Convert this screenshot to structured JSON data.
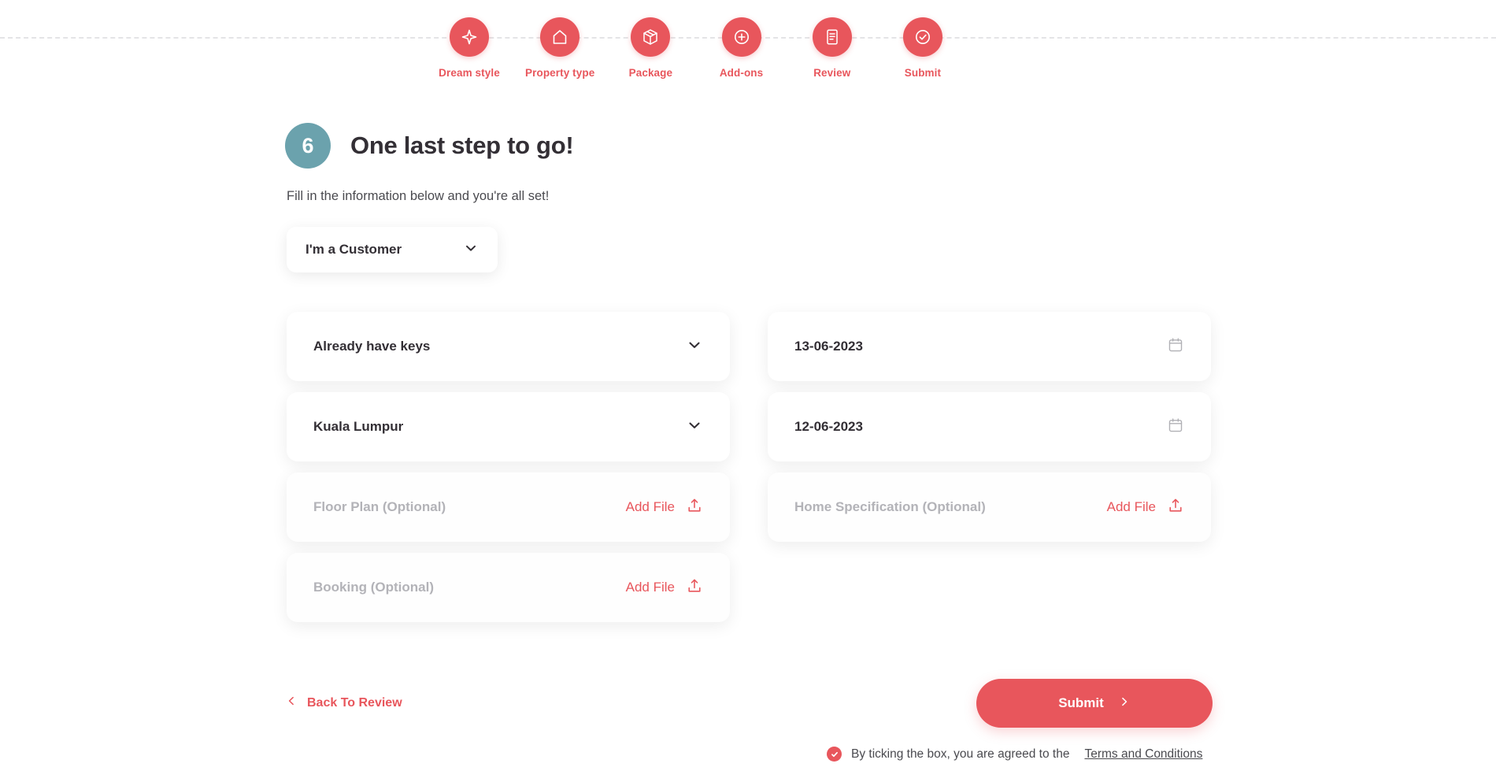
{
  "colors": {
    "accent": "#e8565c",
    "badge_teal": "#6ba2ad",
    "text_dark": "#332f35",
    "text_muted": "#b3b3b8",
    "line": "#e4e4e6"
  },
  "stepper": {
    "steps": [
      {
        "label": "Dream style",
        "icon": "sparkle-icon"
      },
      {
        "label": "Property type",
        "icon": "house-icon"
      },
      {
        "label": "Package",
        "icon": "package-icon"
      },
      {
        "label": "Add-ons",
        "icon": "plus-circle-icon"
      },
      {
        "label": "Review",
        "icon": "document-list-icon"
      },
      {
        "label": "Submit",
        "icon": "check-circle-icon"
      }
    ]
  },
  "heading": {
    "step_number": "6",
    "title": "One last step to go!",
    "subtitle": "Fill in the information below and you're all set!"
  },
  "role_select": {
    "value": "I'm a Customer"
  },
  "form": {
    "rows": [
      {
        "left": {
          "kind": "select",
          "value": "Already have keys"
        },
        "right": {
          "kind": "date",
          "value": "13-06-2023"
        }
      },
      {
        "left": {
          "kind": "select",
          "value": "Kuala Lumpur"
        },
        "right": {
          "kind": "date",
          "value": "12-06-2023"
        }
      },
      {
        "left": {
          "kind": "file",
          "value": "Floor Plan (Optional)",
          "action": "Add File"
        },
        "right": {
          "kind": "file",
          "value": "Home Specification (Optional)",
          "action": "Add File"
        }
      },
      {
        "left": {
          "kind": "file",
          "value": "Booking (Optional)",
          "action": "Add File"
        },
        "right": {
          "kind": "empty"
        }
      }
    ]
  },
  "footer": {
    "back_label": "Back To Review",
    "submit_label": "Submit",
    "terms_text": "By ticking the box, you are agreed to the",
    "terms_link": "Terms and Conditions",
    "terms_checked": true
  }
}
